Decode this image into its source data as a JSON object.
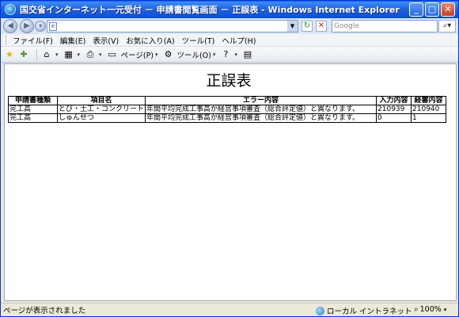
{
  "window": {
    "title": "国交省インターネット一元受付 － 申請書閲覧画面 － 正誤表 - Windows Internet Explorer",
    "minimize": "_",
    "maximize": "□",
    "close": "✕"
  },
  "address_bar": {
    "url": "",
    "search_placeholder": "Google"
  },
  "menu": {
    "items": [
      "ファイル(F)",
      "編集(E)",
      "表示(V)",
      "お気に入り(A)",
      "ツール(T)",
      "ヘルプ(H)"
    ]
  },
  "toolbar": {
    "page_label": "ページ(P)",
    "tools_label": "ツール(O)"
  },
  "page": {
    "heading": "正誤表",
    "table": {
      "headers": [
        "申請書種類",
        "項目名",
        "エラー内容",
        "入力内容",
        "経審内容"
      ],
      "rows": [
        [
          "完工高",
          "とび・土工・コンクリート",
          "年間平均完成工事高が経営事項審査（総合評定値）と異なります。",
          "210939",
          "210940"
        ],
        [
          "完工高",
          "しゅんせつ",
          "年間平均完成工事高が経営事項審査（総合評定値）と異なります。",
          "0",
          "1"
        ]
      ]
    }
  },
  "status": {
    "text": "ページが表示されました",
    "zone": "ローカル イントラネット",
    "zoom": "100%"
  },
  "colors": {
    "titlebar": "#0d53d6",
    "chrome": "#ece9d8"
  }
}
